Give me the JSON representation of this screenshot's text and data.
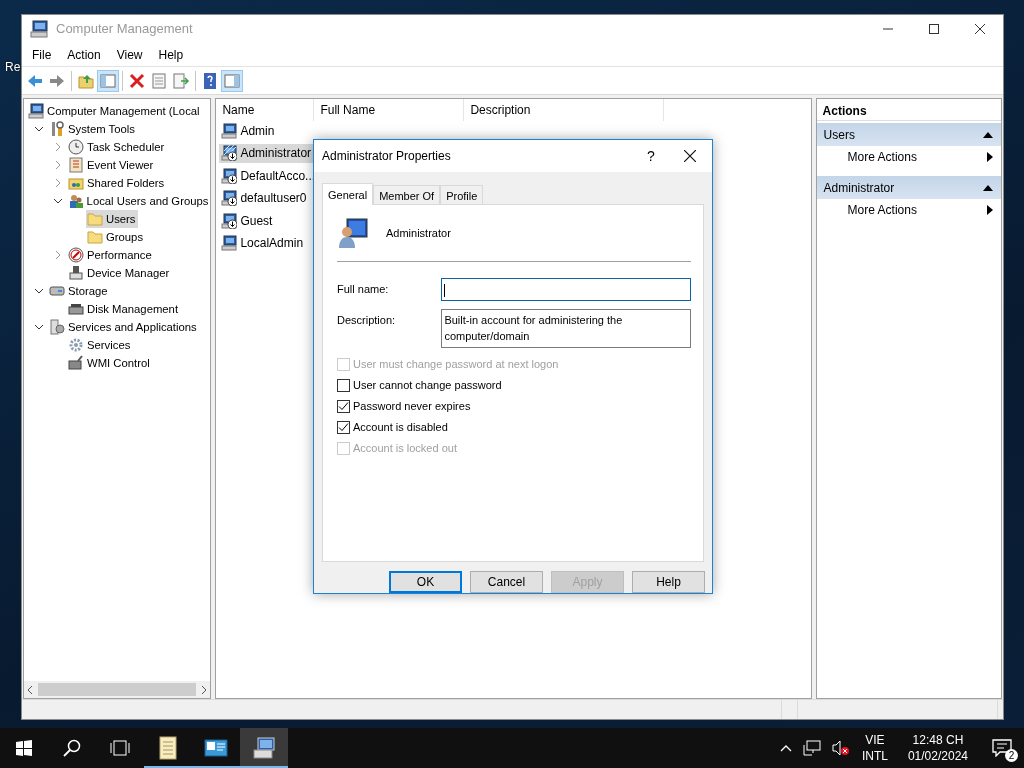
{
  "desktop": {
    "icon_label": "Re"
  },
  "window": {
    "title": "Computer Management",
    "menu": [
      "File",
      "Action",
      "View",
      "Help"
    ],
    "toolbar": [
      {
        "kind": "back",
        "pressed": false
      },
      {
        "kind": "forward",
        "pressed": false
      },
      {
        "kind": "separator"
      },
      {
        "kind": "up",
        "pressed": false
      },
      {
        "kind": "tree",
        "pressed": true
      },
      {
        "kind": "separator"
      },
      {
        "kind": "delete",
        "pressed": false
      },
      {
        "kind": "properties",
        "pressed": false
      },
      {
        "kind": "export",
        "pressed": false
      },
      {
        "kind": "separator"
      },
      {
        "kind": "help",
        "pressed": false
      },
      {
        "kind": "actionpane",
        "pressed": true
      }
    ]
  },
  "tree": [
    {
      "label": "Computer Management (Local",
      "selected": false,
      "children": [
        {
          "label": "System Tools",
          "selected": false,
          "expanded": true,
          "children": [
            {
              "label": "Task Scheduler",
              "selected": false,
              "expanded": false
            },
            {
              "label": "Event Viewer",
              "selected": false,
              "expanded": false
            },
            {
              "label": "Shared Folders",
              "selected": false,
              "expanded": false
            },
            {
              "label": "Local Users and Groups",
              "selected": false,
              "expanded": true,
              "children": [
                {
                  "label": "Users",
                  "selected": true
                },
                {
                  "label": "Groups",
                  "selected": false
                }
              ]
            },
            {
              "label": "Performance",
              "selected": false,
              "expanded": false
            },
            {
              "label": "Device Manager",
              "selected": false
            }
          ]
        },
        {
          "label": "Storage",
          "selected": false,
          "expanded": true,
          "children": [
            {
              "label": "Disk Management",
              "selected": false
            }
          ]
        },
        {
          "label": "Services and Applications",
          "selected": false,
          "expanded": true,
          "children": [
            {
              "label": "Services",
              "selected": false
            },
            {
              "label": "WMI Control",
              "selected": false
            }
          ]
        }
      ]
    }
  ],
  "users_list": {
    "columns": [
      "Name",
      "Full Name",
      "Description"
    ],
    "rows": [
      {
        "name": "Admin",
        "selected": false,
        "disabled": false
      },
      {
        "name": "Administrator",
        "selected": true,
        "disabled": true
      },
      {
        "name": "DefaultAcco...",
        "selected": false,
        "disabled": true
      },
      {
        "name": "defaultuser0",
        "selected": false,
        "disabled": true
      },
      {
        "name": "Guest",
        "selected": false,
        "disabled": true
      },
      {
        "name": "LocalAdmin",
        "selected": false,
        "disabled": false
      }
    ]
  },
  "actions": {
    "title": "Actions",
    "sections": [
      {
        "title": "Users",
        "expanded": true,
        "items": [
          "More Actions"
        ]
      },
      {
        "title": "Administrator",
        "expanded": true,
        "items": [
          "More Actions"
        ]
      }
    ]
  },
  "dialog": {
    "title": "Administrator Properties",
    "help": "?",
    "tabs": [
      {
        "label": "General",
        "selected": true
      },
      {
        "label": "Member Of",
        "selected": false
      },
      {
        "label": "Profile",
        "selected": false
      }
    ],
    "user_name": "Administrator",
    "fields": [
      {
        "label": "Full name:",
        "focused": true
      },
      {
        "label": "Description:",
        "value": "Built-in account for administering the computer/domain",
        "focused": false
      }
    ],
    "options": [
      {
        "label": "User must change password at next logon",
        "checked": false,
        "disabled": true
      },
      {
        "label": "User cannot change password",
        "checked": false,
        "disabled": false
      },
      {
        "label": "Password never expires",
        "checked": true,
        "disabled": false
      },
      {
        "label": "Account is disabled",
        "checked": true,
        "disabled": false
      },
      {
        "label": "Account is locked out",
        "checked": false,
        "disabled": true
      }
    ],
    "buttons": [
      {
        "label": "OK",
        "default": true,
        "disabled": false
      },
      {
        "label": "Cancel",
        "default": false,
        "disabled": false
      },
      {
        "label": "Apply",
        "default": false,
        "disabled": true
      },
      {
        "label": "Help",
        "default": false,
        "disabled": false
      }
    ]
  },
  "taskbar": {
    "apps": [
      {
        "running": true,
        "active": false
      },
      {
        "running": true,
        "active": false
      },
      {
        "running": true,
        "active": true
      }
    ],
    "language": [
      "VIE",
      "INTL"
    ],
    "time": "12:48 CH",
    "date": "01/02/2024",
    "notifications": "2"
  }
}
